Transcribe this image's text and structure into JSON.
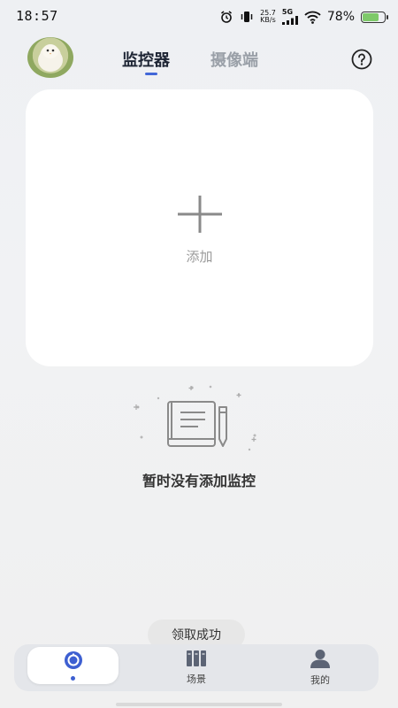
{
  "status_bar": {
    "time": "18:57",
    "net_speed_value": "25.7",
    "net_speed_unit": "KB/s",
    "network": "5G",
    "battery_percent": "78%",
    "battery_level": 0.78,
    "icons": [
      "alarm-icon",
      "vibrate-icon",
      "signal-icon",
      "wifi-icon",
      "battery-icon"
    ]
  },
  "header": {
    "tabs": [
      {
        "label": "监控器",
        "active": true
      },
      {
        "label": "摄像端",
        "active": false
      }
    ],
    "help_icon": "question-circle-icon",
    "accent_color": "#4267d8"
  },
  "add_card": {
    "icon": "plus-icon",
    "label": "添加"
  },
  "empty_state": {
    "icon": "notebook-pencil-icon",
    "message": "暂时没有添加监控"
  },
  "toast": {
    "text": "领取成功"
  },
  "bottom_nav": {
    "items": [
      {
        "label": "",
        "icon": "home-monitor-icon",
        "active": true
      },
      {
        "label": "场景",
        "icon": "books-icon",
        "active": false
      },
      {
        "label": "我的",
        "icon": "person-icon",
        "active": false
      }
    ]
  }
}
